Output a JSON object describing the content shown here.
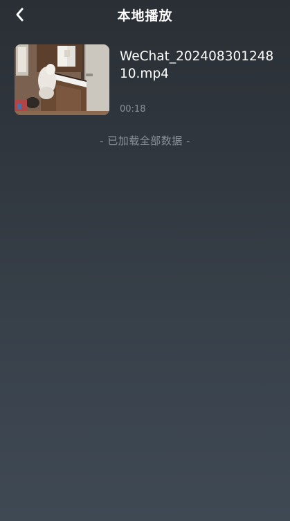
{
  "header": {
    "title": "本地播放",
    "back_icon": "chevron-left-icon"
  },
  "videos": [
    {
      "file_name": "WeChat_20240830124810.mp4",
      "duration": "00:18",
      "thumbnail_icon": "video-thumbnail"
    }
  ],
  "list_status": "- 已加载全部数据 -",
  "colors": {
    "background_top": "#2a2f35",
    "background_bottom": "#3f4954",
    "text_primary": "#ffffff",
    "text_secondary": "#8b929b"
  }
}
